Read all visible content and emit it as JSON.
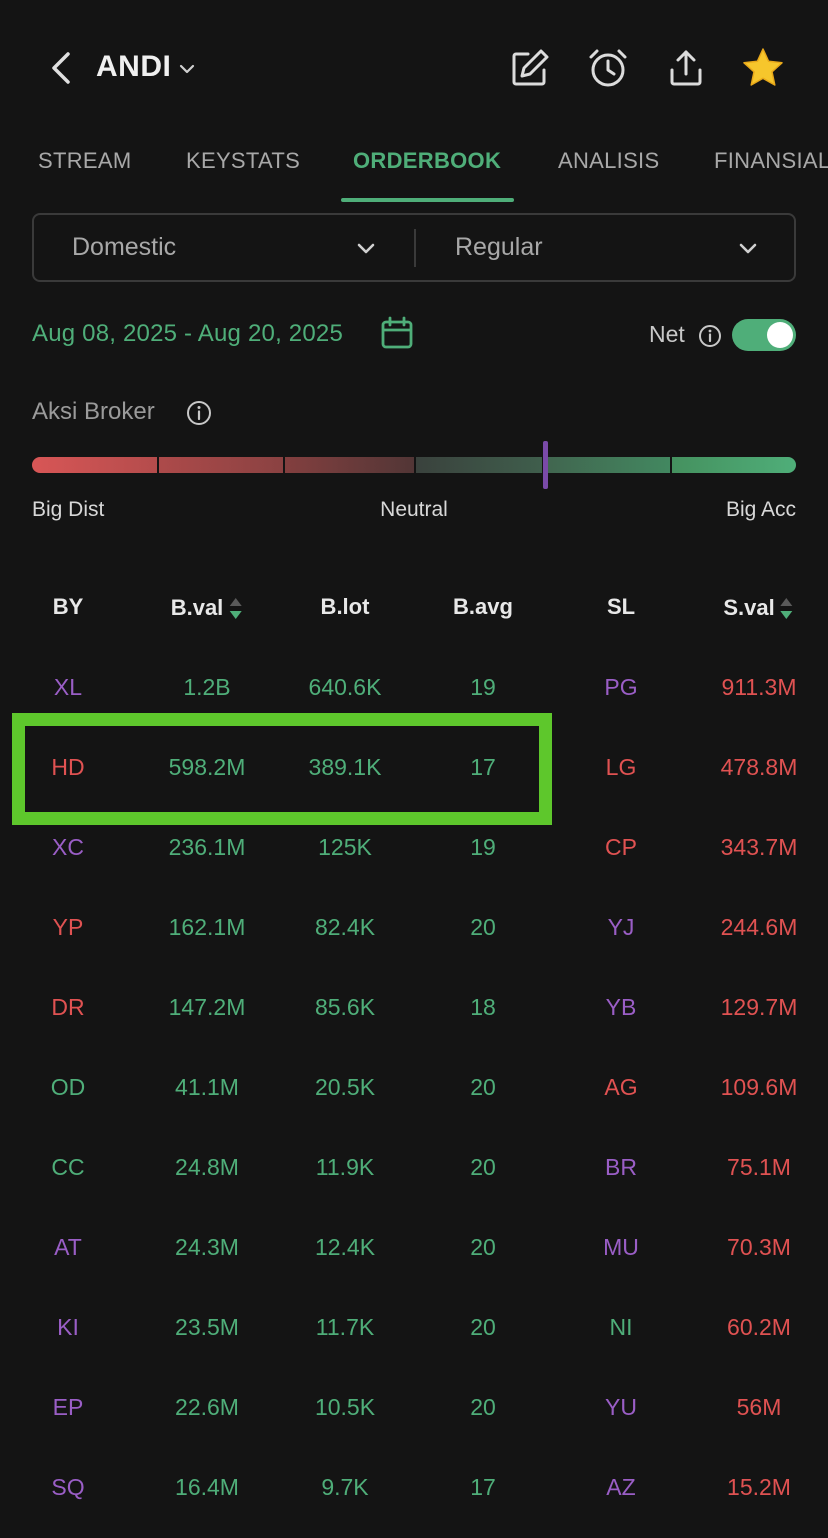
{
  "header": {
    "title": "ANDI"
  },
  "tabs": [
    "STREAM",
    "KEYSTATS",
    "ORDERBOOK",
    "ANALISIS",
    "FINANSIAL"
  ],
  "active_tab": "ORDERBOOK",
  "filters": {
    "market": "Domestic",
    "board": "Regular"
  },
  "date_range": "Aug 08, 2025 - Aug 20, 2025",
  "net": {
    "label": "Net",
    "enabled": true
  },
  "aksi_broker": {
    "label": "Aksi Broker",
    "left_label": "Big Dist",
    "center_label": "Neutral",
    "right_label": "Big Acc",
    "marker_fraction": 0.672
  },
  "colors": {
    "accent_green": "#4fae79",
    "sell_red": "#e05252",
    "foreign_purple": "#9a5ec6",
    "highlight_green": "#5ec72c"
  },
  "table": {
    "headers": [
      "BY",
      "B.val",
      "B.lot",
      "B.avg",
      "SL",
      "S.val"
    ],
    "rows": [
      {
        "by": "XL",
        "by_color": "purple",
        "bval": "1.2B",
        "blot": "640.6K",
        "bavg": "19",
        "sl": "PG",
        "sl_color": "purple",
        "sval": "911.3M"
      },
      {
        "by": "HD",
        "by_color": "red",
        "bval": "598.2M",
        "blot": "389.1K",
        "bavg": "17",
        "sl": "LG",
        "sl_color": "red",
        "sval": "478.8M"
      },
      {
        "by": "XC",
        "by_color": "purple",
        "bval": "236.1M",
        "blot": "125K",
        "bavg": "19",
        "sl": "CP",
        "sl_color": "red",
        "sval": "343.7M"
      },
      {
        "by": "YP",
        "by_color": "red",
        "bval": "162.1M",
        "blot": "82.4K",
        "bavg": "20",
        "sl": "YJ",
        "sl_color": "purple",
        "sval": "244.6M"
      },
      {
        "by": "DR",
        "by_color": "red",
        "bval": "147.2M",
        "blot": "85.6K",
        "bavg": "18",
        "sl": "YB",
        "sl_color": "purple",
        "sval": "129.7M"
      },
      {
        "by": "OD",
        "by_color": "green",
        "bval": "41.1M",
        "blot": "20.5K",
        "bavg": "20",
        "sl": "AG",
        "sl_color": "red",
        "sval": "109.6M"
      },
      {
        "by": "CC",
        "by_color": "green",
        "bval": "24.8M",
        "blot": "11.9K",
        "bavg": "20",
        "sl": "BR",
        "sl_color": "purple",
        "sval": "75.1M"
      },
      {
        "by": "AT",
        "by_color": "purple",
        "bval": "24.3M",
        "blot": "12.4K",
        "bavg": "20",
        "sl": "MU",
        "sl_color": "purple",
        "sval": "70.3M"
      },
      {
        "by": "KI",
        "by_color": "purple",
        "bval": "23.5M",
        "blot": "11.7K",
        "bavg": "20",
        "sl": "NI",
        "sl_color": "green",
        "sval": "60.2M"
      },
      {
        "by": "EP",
        "by_color": "purple",
        "bval": "22.6M",
        "blot": "10.5K",
        "bavg": "20",
        "sl": "YU",
        "sl_color": "purple",
        "sval": "56M"
      },
      {
        "by": "SQ",
        "by_color": "purple",
        "bval": "16.4M",
        "blot": "9.7K",
        "bavg": "17",
        "sl": "AZ",
        "sl_color": "purple",
        "sval": "15.2M"
      }
    ],
    "highlighted_row": "HD"
  }
}
